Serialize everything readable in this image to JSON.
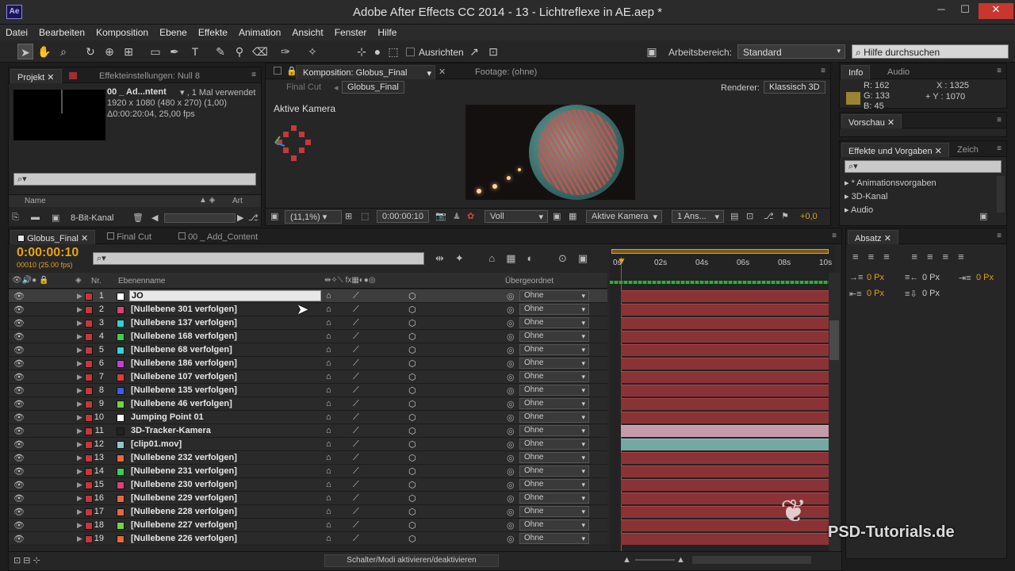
{
  "window": {
    "title": "Adobe After Effects CC 2014 - 13 - Lichtreflexe in AE.aep *",
    "icon_label": "Ae"
  },
  "menu": [
    "Datei",
    "Bearbeiten",
    "Komposition",
    "Ebene",
    "Effekte",
    "Animation",
    "Ansicht",
    "Fenster",
    "Hilfe"
  ],
  "toolbar": {
    "align_label": "Ausrichten",
    "workspace_label": "Arbeitsbereich:",
    "workspace_value": "Standard",
    "help_placeholder": "Hilfe durchsuchen"
  },
  "project": {
    "tabs": [
      "Projekt",
      "Effekteinstellungen: Null 8"
    ],
    "item_name": "00 _ Ad...ntent",
    "item_usage": "▾ , 1 Mal verwendet",
    "item_size": "1920 x 1080 (480 x 270) (1,00)",
    "item_duration": "Δ0:00:20:04, 25,00 fps",
    "search_placeholder": "",
    "col_name": "Name",
    "col_type": "Art",
    "bit_depth": "8-Bit-Kanal"
  },
  "viewer": {
    "tabs": [
      "Komposition: Globus_Final",
      "Footage: (ohne)"
    ],
    "breadcrumb": [
      "Final Cut",
      "Globus_Final"
    ],
    "renderer_label": "Renderer:",
    "renderer_value": "Klassisch 3D",
    "camera_label": "Aktive Kamera",
    "zoom": "(11,1%)",
    "timecode": "0:00:00:10",
    "resolution": "Voll",
    "view": "Aktive Kamera",
    "views": "1 Ans...",
    "exposure": "+0,0"
  },
  "info": {
    "tabs": [
      "Info",
      "Audio"
    ],
    "r": "R:  162",
    "g": "G:  133",
    "b": "B:  45",
    "x": "X : 1325",
    "y": "+ Y : 1070",
    "swatch": "#9a8431"
  },
  "preview": {
    "tab": "Vorschau"
  },
  "effects": {
    "tabs": [
      "Effekte und Vorgaben",
      "Zeich"
    ],
    "items": [
      "* Animationsvorgaben",
      "3D-Kanal",
      "Audio"
    ]
  },
  "paragraph": {
    "tab": "Absatz",
    "fields": [
      "0 Px",
      "0 Px",
      "0 Px",
      "0 Px",
      "0 Px"
    ]
  },
  "timeline": {
    "tabs": [
      "Globus_Final",
      "Final Cut",
      "00 _ Add_Content"
    ],
    "timecode": "0:00:00:10",
    "fps": "00010 (25.00 fps)",
    "col_nr": "Nr.",
    "col_name": "Ebenenname",
    "col_parent": "Übergeordnet",
    "ruler": [
      "0s",
      "02s",
      "04s",
      "06s",
      "08s",
      "10s"
    ],
    "bottom_label": "Schalter/Modi aktivieren/deaktivieren",
    "layers": [
      {
        "nr": "1",
        "name": "JO",
        "color": "#ffffff",
        "parent": "Ohne",
        "sel": true
      },
      {
        "nr": "2",
        "name": "[Nullebene 301 verfolgen]",
        "color": "#e0407a",
        "parent": "Ohne"
      },
      {
        "nr": "3",
        "name": "[Nullebene 137 verfolgen]",
        "color": "#2fd4d0",
        "parent": "Ohne"
      },
      {
        "nr": "4",
        "name": "[Nullebene 168 verfolgen]",
        "color": "#3ccf53",
        "parent": "Ohne"
      },
      {
        "nr": "5",
        "name": "[Nullebene 68 verfolgen]",
        "color": "#34d6d6",
        "parent": "Ohne"
      },
      {
        "nr": "6",
        "name": "[Nullebene 186 verfolgen]",
        "color": "#c63ed6",
        "parent": "Ohne"
      },
      {
        "nr": "7",
        "name": "[Nullebene 107 verfolgen]",
        "color": "#e33b3b",
        "parent": "Ohne"
      },
      {
        "nr": "8",
        "name": "[Nullebene 135 verfolgen]",
        "color": "#3d5ee0",
        "parent": "Ohne"
      },
      {
        "nr": "9",
        "name": "[Nullebene 46 verfolgen]",
        "color": "#6fd63c",
        "parent": "Ohne"
      },
      {
        "nr": "10",
        "name": "Jumping Point 01",
        "color": "#ffffff",
        "parent": "Ohne"
      },
      {
        "nr": "11",
        "name": "3D-Tracker-Kamera",
        "color": "#222222",
        "parent": "Ohne"
      },
      {
        "nr": "12",
        "name": "[clip01.mov]",
        "color": "#8fc9c7",
        "parent": "Ohne"
      },
      {
        "nr": "13",
        "name": "[Nullebene 232 verfolgen]",
        "color": "#e8683b",
        "parent": "Ohne"
      },
      {
        "nr": "14",
        "name": "[Nullebene 231 verfolgen]",
        "color": "#3ccf53",
        "parent": "Ohne"
      },
      {
        "nr": "15",
        "name": "[Nullebene 230 verfolgen]",
        "color": "#e0407a",
        "parent": "Ohne"
      },
      {
        "nr": "16",
        "name": "[Nullebene 229 verfolgen]",
        "color": "#e8683b",
        "parent": "Ohne"
      },
      {
        "nr": "17",
        "name": "[Nullebene 228 verfolgen]",
        "color": "#e8683b",
        "parent": "Ohne"
      },
      {
        "nr": "18",
        "name": "[Nullebene 227 verfolgen]",
        "color": "#6fd63c",
        "parent": "Ohne"
      },
      {
        "nr": "19",
        "name": "[Nullebene 226 verfolgen]",
        "color": "#e8683b",
        "parent": "Ohne"
      }
    ]
  },
  "watermark": "PSD-Tutorials.de"
}
